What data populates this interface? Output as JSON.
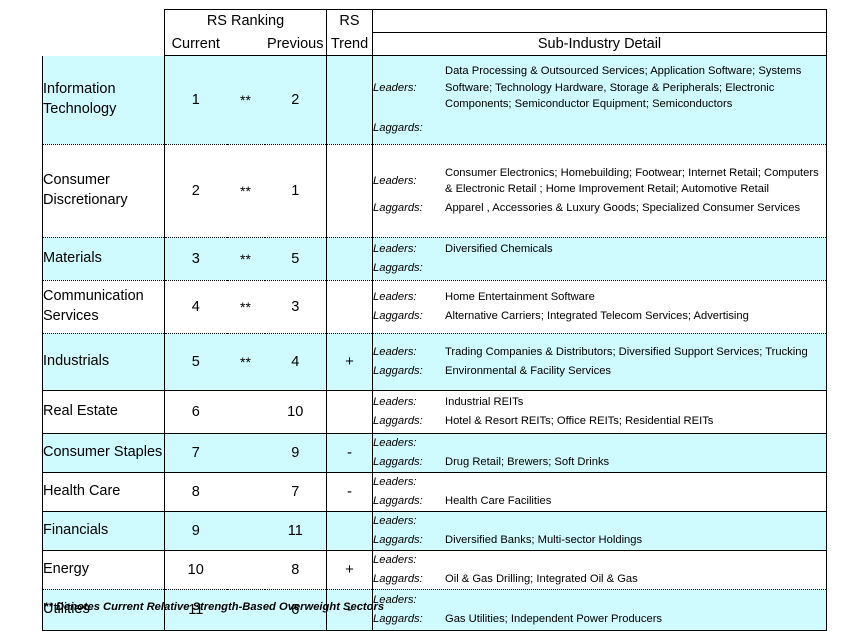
{
  "header": {
    "group_label": "RS Ranking",
    "current_label": "Current",
    "previous_label": "Previous",
    "trend_line1": "RS",
    "trend_line2": "Trend",
    "detail_label": "Sub-Industry Detail",
    "leaders_label": "Leaders:",
    "laggards_label": "Laggards:"
  },
  "rows": [
    {
      "sector": "Information Technology",
      "current": "1",
      "overweight": "**",
      "previous": "2",
      "trend": "",
      "leaders": "Data Processing & Outsourced Services; Application Software; Systems Software; Technology Hardware, Storage & Peripherals; Electronic Components; Semiconductor Equipment; Semiconductors",
      "laggards": "",
      "band": "cyan",
      "separator": "none"
    },
    {
      "sector": "Consumer Discretionary",
      "current": "2",
      "overweight": "**",
      "previous": "1",
      "trend": "",
      "leaders": "Consumer Electronics; Homebuilding; Footwear; Internet Retail; Computers & Electronic Retail ; Home Improvement Retail; Automotive Retail",
      "laggards": "Apparel , Accessories & Luxury Goods; Specialized Consumer Services",
      "band": "white",
      "separator": "dotted"
    },
    {
      "sector": "Materials",
      "current": "3",
      "overweight": "**",
      "previous": "5",
      "trend": "",
      "leaders": "Diversified Chemicals",
      "laggards": "",
      "band": "cyan",
      "separator": "dotted"
    },
    {
      "sector": "Communication Services",
      "current": "4",
      "overweight": "**",
      "previous": "3",
      "trend": "",
      "leaders": "Home Entertainment Software",
      "laggards": "Alternative Carriers; Integrated Telecom Services; Advertising",
      "band": "white",
      "separator": "dotted"
    },
    {
      "sector": "Industrials",
      "current": "5",
      "overweight": "**",
      "previous": "4",
      "trend": "+",
      "leaders": "Trading Companies & Distributors; Diversified Support Services; Trucking",
      "laggards": "Environmental & Facility Services",
      "band": "cyan",
      "separator": "dotted"
    },
    {
      "sector": "Real Estate",
      "current": "6",
      "overweight": "",
      "previous": "10",
      "trend": "",
      "leaders": "Industrial REITs",
      "laggards": "Hotel & Resort REITs; Office REITs; Residential REITs",
      "band": "white",
      "separator": "solid"
    },
    {
      "sector": "Consumer Staples",
      "current": "7",
      "overweight": "",
      "previous": "9",
      "trend": "-",
      "leaders": "",
      "laggards": "Drug Retail; Brewers; Soft Drinks",
      "band": "cyan",
      "separator": "solid"
    },
    {
      "sector": "Health Care",
      "current": "8",
      "overweight": "",
      "previous": "7",
      "trend": "-",
      "leaders": "",
      "laggards": "Health Care Facilities",
      "band": "white",
      "separator": "solid"
    },
    {
      "sector": "Financials",
      "current": "9",
      "overweight": "",
      "previous": "11",
      "trend": "",
      "leaders": "",
      "laggards": "Diversified Banks; Multi-sector Holdings",
      "band": "cyan",
      "separator": "solid"
    },
    {
      "sector": "Energy",
      "current": "10",
      "overweight": "",
      "previous": "8",
      "trend": "+",
      "leaders": "",
      "laggards": "Oil & Gas Drilling; Integrated Oil & Gas",
      "band": "white",
      "separator": "solid"
    },
    {
      "sector": "Utilities",
      "current": "11",
      "overweight": "",
      "previous": "6",
      "trend": "-",
      "leaders": "",
      "laggards": "Gas Utilities; Independent Power Producers",
      "band": "cyan",
      "separator": "dotted"
    }
  ],
  "footnote": "** Denotes Current Relative Strength-Based Overweight Sectors",
  "colors": {
    "band": "#CFFAFE",
    "border": "#000000",
    "text": "#000000"
  }
}
